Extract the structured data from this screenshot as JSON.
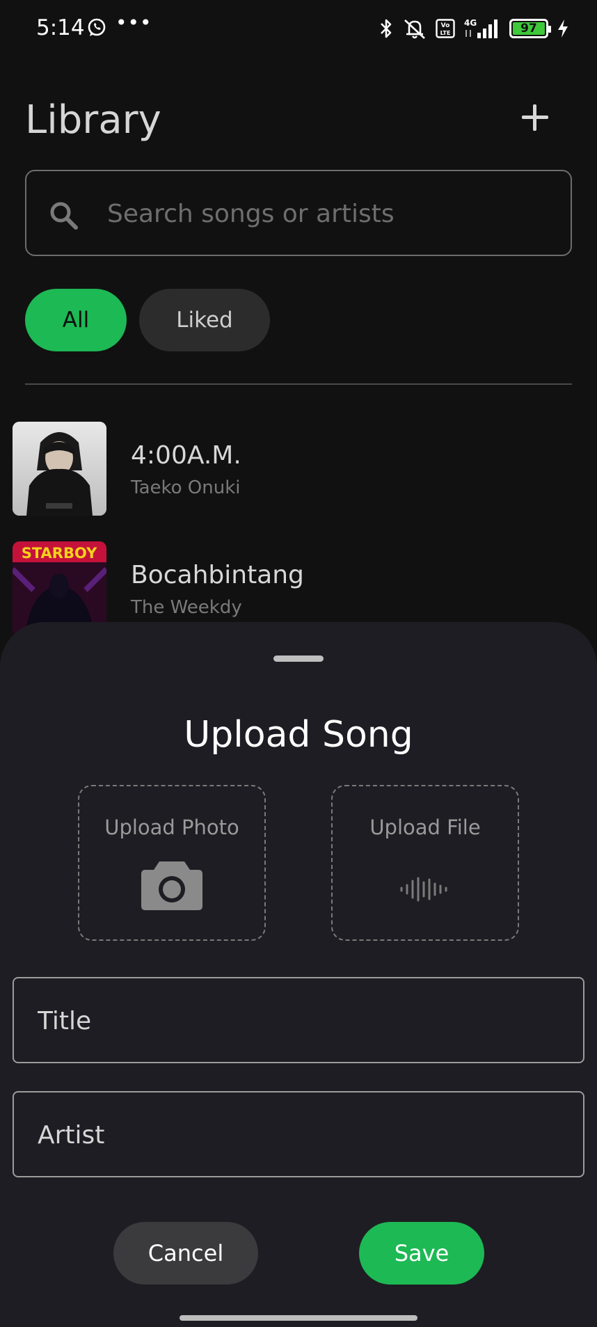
{
  "status_bar": {
    "time": "5:14",
    "battery_level": "97",
    "network": "4G",
    "icons": [
      "whatsapp-icon",
      "more-dots-icon",
      "bluetooth-icon",
      "muted-icon",
      "volte-icon",
      "signal-icon",
      "battery-icon",
      "charging-icon"
    ]
  },
  "header": {
    "title": "Library",
    "add_icon": "plus-icon"
  },
  "search": {
    "placeholder": "Search songs or artists",
    "value": ""
  },
  "filters": [
    {
      "label": "All",
      "selected": true
    },
    {
      "label": "Liked",
      "selected": false
    }
  ],
  "songs": [
    {
      "title": "4:00A.M.",
      "artist": "Taeko Onuki"
    },
    {
      "title": "Bocahbintang",
      "artist": "The Weekdy",
      "cover_text": "STARBOY"
    }
  ],
  "upload_sheet": {
    "title": "Upload Song",
    "upload_photo_label": "Upload Photo",
    "upload_file_label": "Upload File",
    "title_placeholder": "Title",
    "artist_placeholder": "Artist",
    "cancel_label": "Cancel",
    "save_label": "Save"
  },
  "colors": {
    "accent": "#1db954",
    "background": "#111111",
    "sheet": "#1e1d23"
  }
}
